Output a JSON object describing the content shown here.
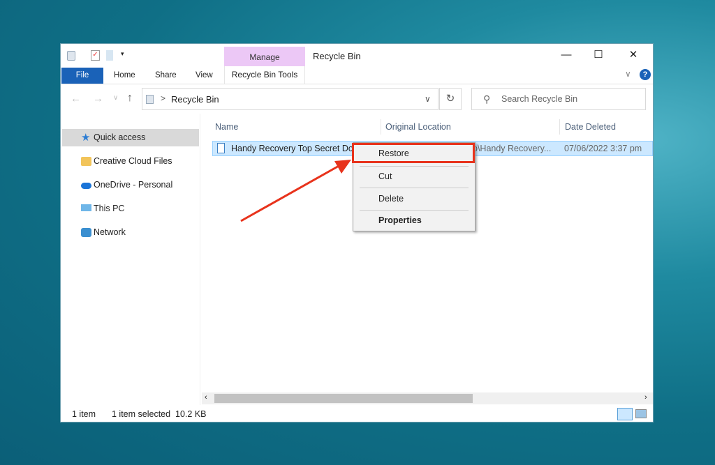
{
  "window": {
    "title": "Recycle Bin",
    "minimize": "—",
    "maximize": "☐",
    "close": "✕"
  },
  "ribbon": {
    "context_group": "Manage",
    "context_tab": "Recycle Bin Tools",
    "tabs": [
      "File",
      "Home",
      "Share",
      "View"
    ],
    "help": "?",
    "expand": "∨"
  },
  "nav": {
    "back": "←",
    "forward": "→",
    "recent": "∨",
    "up": "↑",
    "refresh": "↻",
    "dropdown": "∨",
    "separator": ">"
  },
  "address": {
    "path": "Recycle Bin"
  },
  "search": {
    "placeholder": "Search Recycle Bin"
  },
  "sidebar": {
    "items": [
      {
        "label": "Quick access",
        "icon": "star-icon"
      },
      {
        "label": "Creative Cloud Files",
        "icon": "folder-icon"
      },
      {
        "label": "OneDrive - Personal",
        "icon": "cloud-icon"
      },
      {
        "label": "This PC",
        "icon": "computer-icon"
      },
      {
        "label": "Network",
        "icon": "network-icon"
      }
    ]
  },
  "columns": [
    "Name",
    "Original Location",
    "Date Deleted"
  ],
  "files": [
    {
      "name": "Handy Recovery Top Secret Do",
      "location": "p\\Handy Recovery...",
      "date": "07/06/2022 3:37 pm"
    }
  ],
  "context_menu": {
    "items": [
      "Restore",
      "Cut",
      "Delete",
      "Properties"
    ]
  },
  "status": {
    "count": "1 item",
    "selected": "1 item selected  10.2 KB"
  },
  "colors": {
    "accent": "#1a62b8",
    "highlight": "#e8331c",
    "selection": "#cce8ff",
    "manage": "#ecc8f6"
  }
}
